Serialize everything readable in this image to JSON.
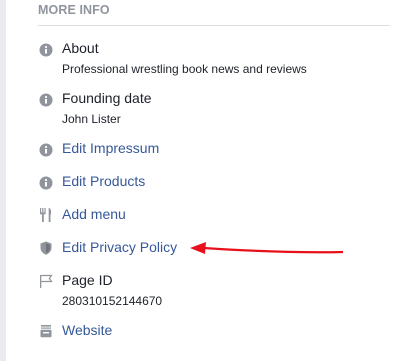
{
  "section": {
    "header": "MORE INFO"
  },
  "items": [
    {
      "icon": "info-icon",
      "title": "About",
      "subtitle": "Professional wrestling book news and reviews",
      "is_link": false
    },
    {
      "icon": "info-icon",
      "title": "Founding date",
      "subtitle": "John Lister",
      "is_link": false
    },
    {
      "icon": "info-icon",
      "title": "Edit Impressum",
      "is_link": true
    },
    {
      "icon": "info-icon",
      "title": "Edit Products",
      "is_link": true
    },
    {
      "icon": "fork-knife-icon",
      "title": "Add menu",
      "is_link": true
    },
    {
      "icon": "shield-icon",
      "title": "Edit Privacy Policy",
      "is_link": true
    },
    {
      "icon": "flag-icon",
      "title": "Page ID",
      "subtitle": "280310152144670",
      "is_link": false
    },
    {
      "icon": "globe-icon",
      "title": "Website",
      "is_link": true
    }
  ],
  "colors": {
    "link": "#365899",
    "text": "#1d2129",
    "header": "#90949c",
    "icon": "#90949c",
    "annotation_arrow": "#e8111b"
  }
}
